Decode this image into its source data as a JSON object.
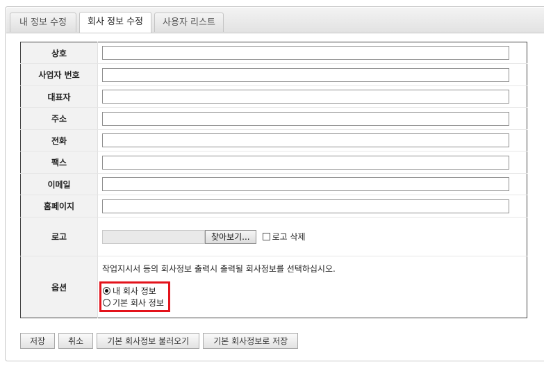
{
  "tabs": [
    {
      "label": "내 정보 수정",
      "active": false
    },
    {
      "label": "회사 정보 수정",
      "active": true
    },
    {
      "label": "사용자 리스트",
      "active": false
    }
  ],
  "form": {
    "company_name": {
      "label": "상호",
      "value": ""
    },
    "business_number": {
      "label": "사업자 번호",
      "value": ""
    },
    "representative": {
      "label": "대표자",
      "value": ""
    },
    "address": {
      "label": "주소",
      "value": ""
    },
    "phone": {
      "label": "전화",
      "value": ""
    },
    "fax": {
      "label": "팩스",
      "value": ""
    },
    "email": {
      "label": "이메일",
      "value": ""
    },
    "homepage": {
      "label": "홈페이지",
      "value": ""
    },
    "logo": {
      "label": "로고",
      "browse_label": "찾아보기...",
      "delete_label": "로고 삭제",
      "delete_checked": false
    },
    "options": {
      "label": "옵션",
      "description": "작업지시서 등의 회사정보 출력시 출력될 회사정보를 선택하십시오.",
      "radios": [
        {
          "label": "내 회사 정보",
          "checked": true
        },
        {
          "label": "기본 회사 정보",
          "checked": false
        }
      ],
      "highlight_color": "#e3131b"
    }
  },
  "buttons": {
    "save": "저장",
    "cancel": "취소",
    "load_default": "기본 회사정보 불러오기",
    "save_default": "기본 회사정보로 저장"
  }
}
